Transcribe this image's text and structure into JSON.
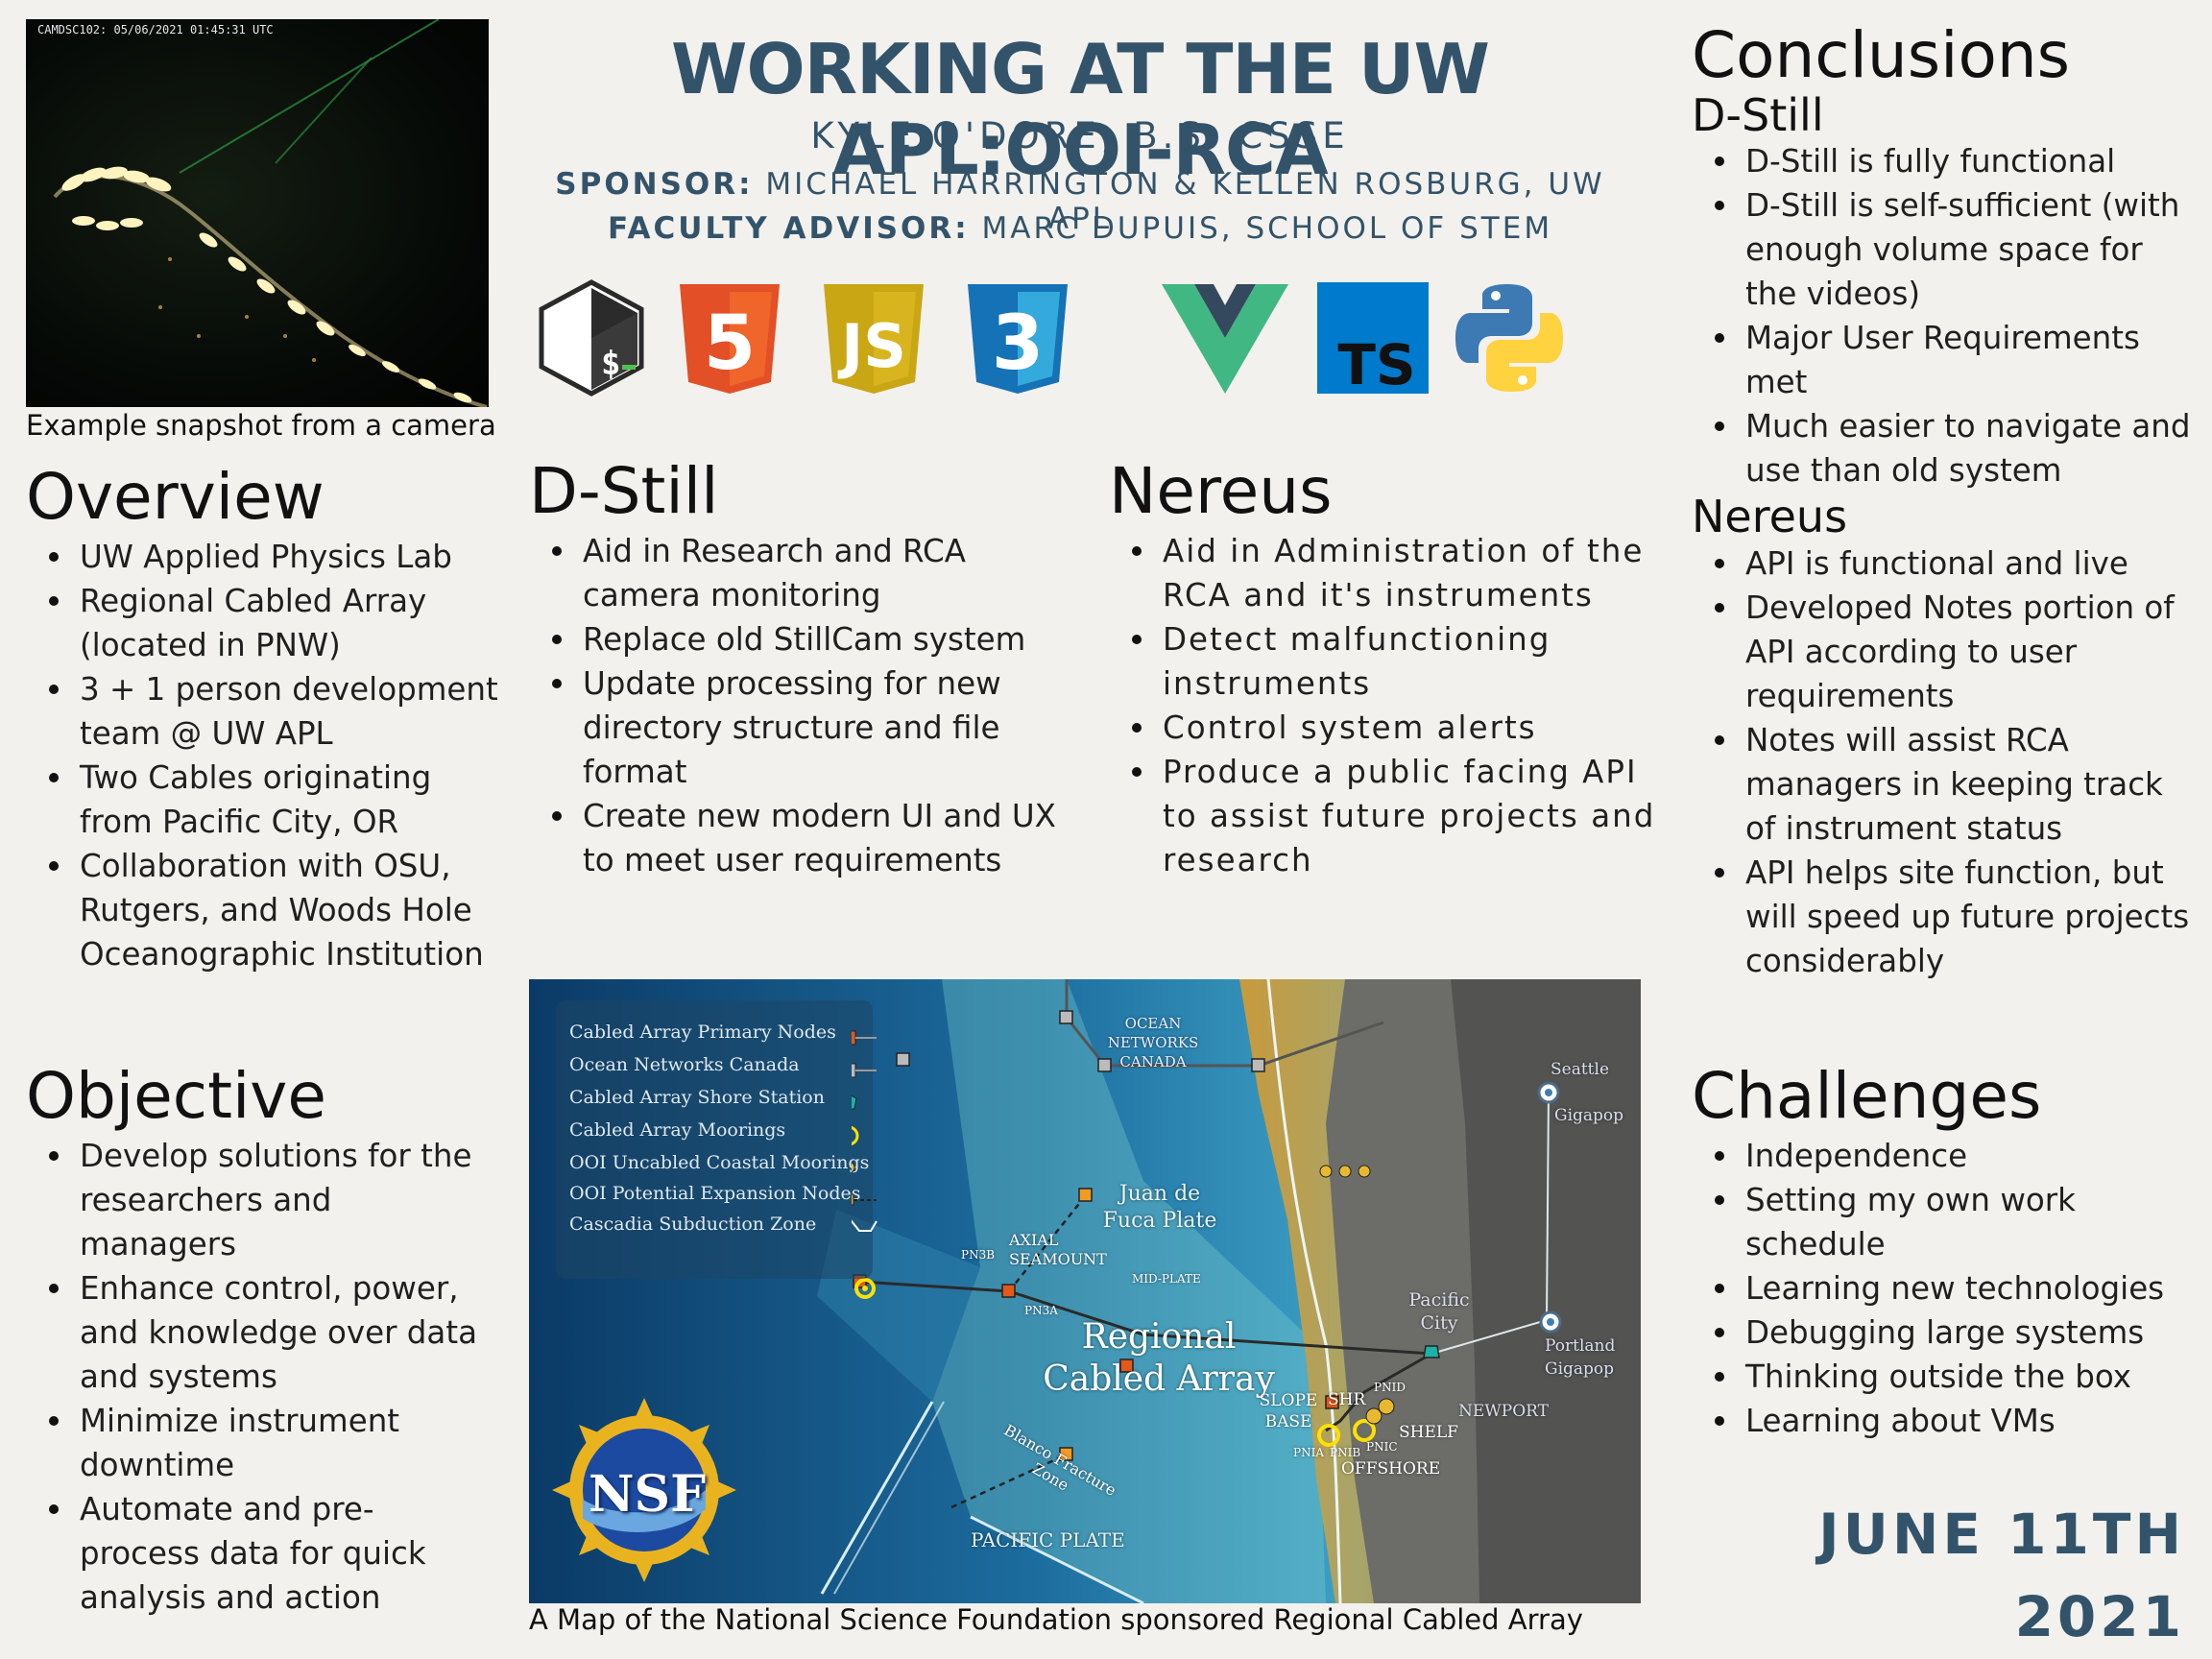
{
  "header": {
    "title": "WORKING AT THE UW APL:OOI-RCA",
    "author": "KYLE O'DORE, B.S. CSSE",
    "sponsor_label": "SPONSOR:",
    "sponsor": "MICHAEL HARRINGTON & KELLEN ROSBURG, UW APL",
    "advisor_label": "FACULTY ADVISOR:",
    "advisor": "MARC DUPUIS, SCHOOL OF STEM"
  },
  "logos": [
    "bash-icon",
    "html5-icon",
    "javascript-icon",
    "css3-icon",
    "vue-icon",
    "typescript-icon",
    "python-icon"
  ],
  "photo": {
    "stamp": "CAMDSC102: 05/06/2021 01:45:31 UTC",
    "caption": "Example snapshot from a camera"
  },
  "overview": {
    "heading": "Overview",
    "items": [
      "UW Applied Physics Lab",
      "Regional Cabled Array (located in PNW)",
      "3 + 1 person development team @ UW APL",
      "Two Cables originating from Pacific City, OR",
      "Collaboration with OSU, Rutgers, and Woods Hole Oceanographic Institution"
    ]
  },
  "objective": {
    "heading": "Objective",
    "items": [
      "Develop solutions for the researchers and managers",
      "Enhance control, power, and knowledge over data and systems",
      "Minimize instrument downtime",
      "Automate and pre-process data for quick analysis and action"
    ]
  },
  "dstill": {
    "heading": "D-Still",
    "items": [
      "Aid in Research and RCA camera monitoring",
      "Replace old StillCam system",
      "Update processing for new directory structure and file format",
      "Create new modern UI and UX to meet user requirements"
    ]
  },
  "nereus": {
    "heading": "Nereus",
    "items": [
      "Aid in Administration of the RCA and it's instruments",
      "Detect malfunctioning instruments",
      "Control system alerts",
      "Produce a public facing API to assist future projects and research"
    ]
  },
  "conclusions": {
    "heading": "Conclusions",
    "dstill_heading": "D-Still",
    "dstill_items": [
      "D-Still is fully functional",
      "D-Still is self-sufficient (with enough volume space for the videos)",
      "Major User Requirements met",
      "Much easier to navigate and use than old system"
    ],
    "nereus_heading": "Nereus",
    "nereus_items": [
      "API is functional and live",
      "Developed Notes portion of API according to user requirements",
      "Notes will assist RCA managers in keeping track of instrument status",
      "API helps site function, but will speed up future projects considerably"
    ]
  },
  "challenges": {
    "heading": "Challenges",
    "items": [
      "Independence",
      "Setting my own work schedule",
      "Learning new technologies",
      "Debugging large systems",
      "Thinking outside the box",
      "Learning about VMs"
    ]
  },
  "map": {
    "caption": "A Map of the National Science Foundation sponsored Regional Cabled Array",
    "legend": [
      "Cabled Array Primary Nodes",
      "Ocean Networks Canada",
      "Cabled Array Shore Station",
      "Cabled Array Moorings",
      "OOI Uncabled Coastal Moorings",
      "OOI Potential Expansion Nodes",
      "Cascadia Subduction Zone"
    ],
    "labels": {
      "onc": "OCEAN NETWORKS CANADA",
      "juan": "Juan de Fuca Plate",
      "axial": "AXIAL SEAMOUNT",
      "pn3b": "PN3B",
      "pn3a": "PN3A",
      "midplate": "MID-PLATE",
      "rca_line1": "Regional",
      "rca_line2": "Cabled Array",
      "slope": "SLOPE BASE",
      "shr": "SHR",
      "pnid": "PNID",
      "pnia": "PNIA",
      "pnib": "PNIB",
      "pnic": "PNIC",
      "shelf": "SHELF",
      "offshore": "OFFSHORE",
      "newport": "NEWPORT",
      "pacific_city": "Pacific City",
      "seattle": "Seattle",
      "seattle_gig": "Gigapop",
      "portland": "Portland",
      "portland_gig": "Gigapop",
      "blanco": "Blanco Fracture Zone",
      "pacific_plate": "PACIFIC PLATE",
      "nsf": "NSF"
    }
  },
  "date": {
    "line1": "JUNE 11TH",
    "line2": "2021"
  },
  "colors": {
    "accent": "#33536a",
    "background": "#f2f1ed"
  }
}
